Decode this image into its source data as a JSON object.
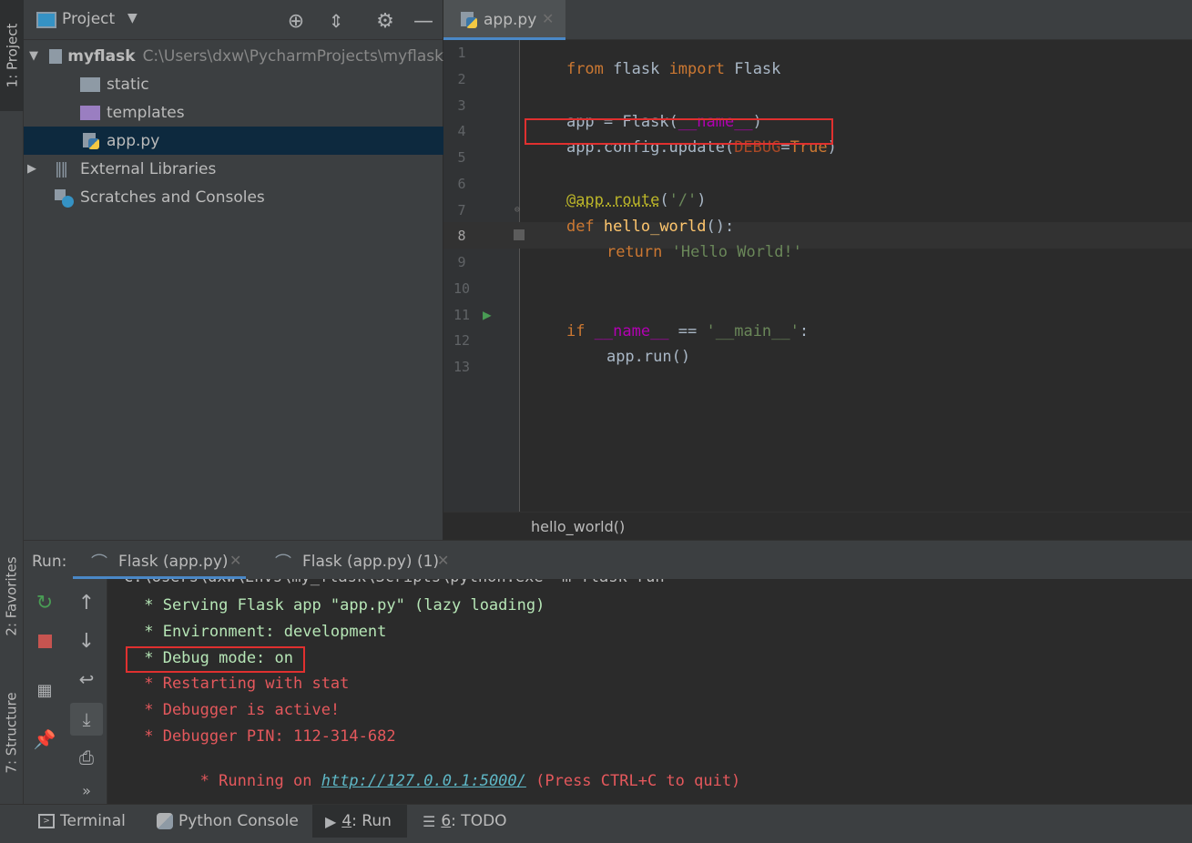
{
  "left_strip": {
    "project_tab": "1: Project",
    "favorites_tab": "2: Favorites",
    "structure_tab": "7: Structure"
  },
  "project_panel": {
    "title": "Project",
    "tree": [
      {
        "label": "myflask",
        "path": "C:\\Users\\dxw\\PycharmProjects\\myflask"
      },
      {
        "label": "static"
      },
      {
        "label": "templates"
      },
      {
        "label": "app.py"
      },
      {
        "label": "External Libraries"
      },
      {
        "label": "Scratches and Consoles"
      }
    ]
  },
  "editor": {
    "tab_label": "app.py",
    "line_numbers": [
      "1",
      "2",
      "3",
      "4",
      "5",
      "6",
      "7",
      "8",
      "9",
      "10",
      "11",
      "12",
      "13"
    ],
    "code": {
      "l1_from": "from",
      "l1_mod": " flask ",
      "l1_import": "import",
      "l1_name": " Flask",
      "l3_a": "app = Flask(",
      "l3_name": "__name__",
      "l3_b": ")",
      "l4_a": "app.config.update(",
      "l4_param": "DEBUG",
      "l4_eq": "=",
      "l4_true": "True",
      "l4_b": ")",
      "l6_deco": "@app.route",
      "l6_paren_a": "(",
      "l6_str": "'/'",
      "l6_paren_b": ")",
      "l7_def": "def",
      "l7_fn": " hello_world",
      "l7_rest": "():",
      "l8_return": "return",
      "l8_str": " 'Hello World!'",
      "l11_if": "if",
      "l11_name": " __name__",
      "l11_eq": " == ",
      "l11_str": "'__main__'",
      "l11_colon": ":",
      "l12": "app.run()"
    },
    "breadcrumb": "hello_world()"
  },
  "run_panel": {
    "label": "Run:",
    "tabs": [
      {
        "label": "Flask (app.py)"
      },
      {
        "label": "Flask (app.py) (1)"
      }
    ],
    "console": {
      "cmd": "C:\\Users\\dxw\\Envs\\my_flask\\Scripts\\python.exe -m flask run",
      "line1": " * Serving Flask app \"app.py\" (lazy loading)",
      "line2": " * Environment: development",
      "line3": " * Debug mode: on",
      "line4": " * Restarting with stat",
      "line5": " * Debugger is active!",
      "line6": " * Debugger PIN: 112-314-682",
      "line7_pre": " * Running on ",
      "line7_link": "http://127.0.0.1:5000/",
      "line7_post": " (Press CTRL+C to quit)"
    },
    "more_glyph": "»"
  },
  "bottom_bar": {
    "terminal": "Terminal",
    "python_console": "Python Console",
    "run_num": "4",
    "run_rest": ": Run",
    "todo_num": "6",
    "todo_rest": ": TODO"
  },
  "colors": {
    "accent_blue": "#4a88c7",
    "highlight_red": "#e0302f",
    "console_green": "#b6e6b6",
    "console_red": "#e4585c",
    "link_green": "#5fb8c7"
  }
}
